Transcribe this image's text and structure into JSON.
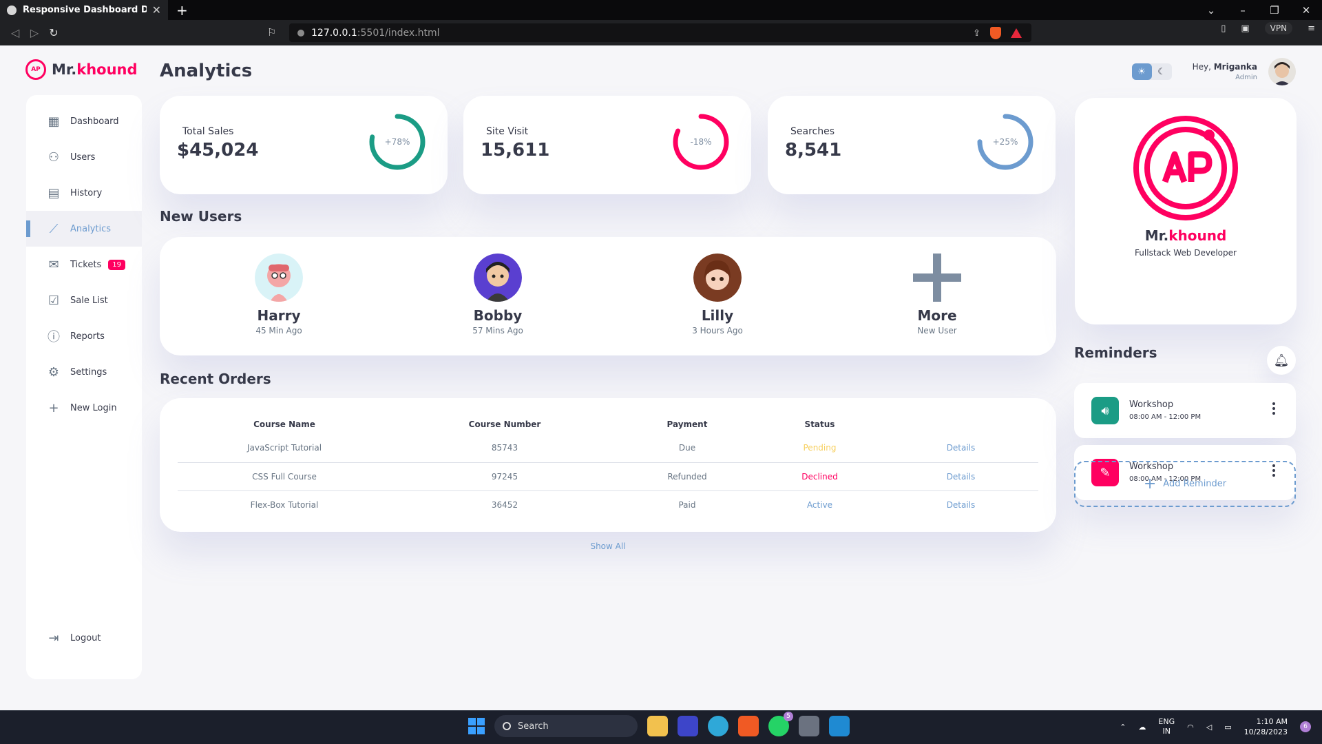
{
  "browser": {
    "tab_title": "Responsive Dashboard Design",
    "url_host": "127.0.0.1",
    "url_path": ":5501/index.html",
    "vpn_label": "VPN"
  },
  "brand": {
    "prefix": "Mr.",
    "accent": "khound"
  },
  "sidebar": {
    "items": [
      {
        "label": "Dashboard",
        "icon": "dashboard-icon"
      },
      {
        "label": "Users",
        "icon": "user-icon"
      },
      {
        "label": "History",
        "icon": "history-icon"
      },
      {
        "label": "Analytics",
        "icon": "analytics-icon",
        "active": true
      },
      {
        "label": "Tickets",
        "icon": "mail-icon",
        "badge": "19"
      },
      {
        "label": "Sale List",
        "icon": "inventory-icon"
      },
      {
        "label": "Reports",
        "icon": "report-icon"
      },
      {
        "label": "Settings",
        "icon": "gear-icon"
      },
      {
        "label": "New Login",
        "icon": "plus-icon"
      }
    ],
    "logout": "Logout"
  },
  "main": {
    "title": "Analytics",
    "stats": [
      {
        "label": "Total Sales",
        "value": "$45,024",
        "percent": "+78%",
        "color": "#1b9c85",
        "fill": 0.78
      },
      {
        "label": "Site Visit",
        "value": "15,611",
        "percent": "-18%",
        "color": "#ff0060",
        "fill": 0.82
      },
      {
        "label": "Searches",
        "value": "8,541",
        "percent": "+25%",
        "color": "#6c9bcf",
        "fill": 0.75
      }
    ],
    "new_users_title": "New Users",
    "users": [
      {
        "name": "Harry",
        "time": "45 Min Ago"
      },
      {
        "name": "Bobby",
        "time": "57 Mins Ago"
      },
      {
        "name": "Lilly",
        "time": "3 Hours Ago"
      },
      {
        "name": "More",
        "time": "New User"
      }
    ],
    "orders_title": "Recent Orders",
    "orders_headers": [
      "Course Name",
      "Course Number",
      "Payment",
      "Status"
    ],
    "orders": [
      {
        "name": "JavaScript Tutorial",
        "number": "85743",
        "payment": "Due",
        "status": "Pending",
        "link": "Details"
      },
      {
        "name": "CSS Full Course",
        "number": "97245",
        "payment": "Refunded",
        "status": "Declined",
        "link": "Details"
      },
      {
        "name": "Flex-Box Tutorial",
        "number": "36452",
        "payment": "Paid",
        "status": "Active",
        "link": "Details"
      }
    ],
    "show_all": "Show All"
  },
  "topbar": {
    "greeting": "Hey,",
    "user_name": "Mriganka",
    "role": "Admin"
  },
  "profile": {
    "name_prefix": "Mr.",
    "name_accent": "khound",
    "role": "Fullstack Web Developer"
  },
  "reminders": {
    "title": "Reminders",
    "items": [
      {
        "title": "Workshop",
        "time": "08:00 AM - 12:00 PM",
        "icon": "volume-icon",
        "color": "#1b9c85"
      },
      {
        "title": "Workshop",
        "time": "08:00 AM - 12:00 PM",
        "icon": "edit-icon",
        "color": "#ff0060"
      }
    ],
    "add_label": "Add Reminder"
  },
  "taskbar": {
    "search_label": "Search",
    "lang_1": "ENG",
    "lang_2": "IN",
    "time": "1:10 AM",
    "date": "10/28/2023",
    "whatsapp_badge": "5",
    "notif_count": "6"
  }
}
